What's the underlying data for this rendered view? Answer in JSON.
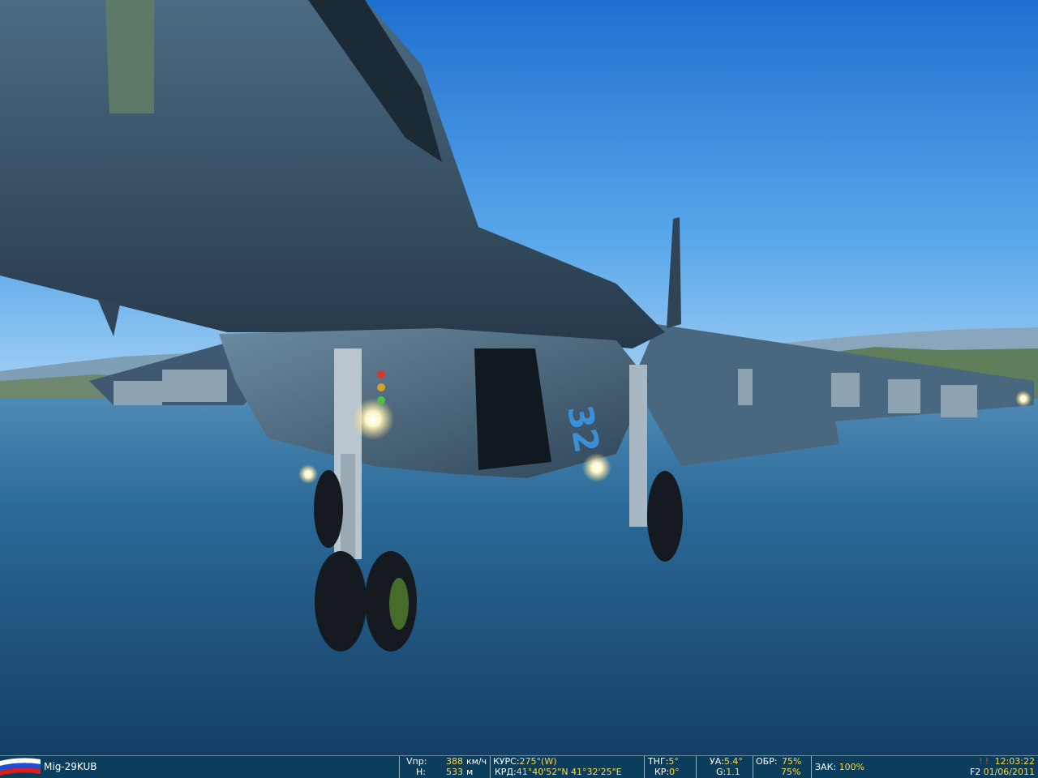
{
  "aircraft": {
    "name": "Mig-29KUB",
    "side_flag": "russia-flag-icon",
    "tail_number": "32"
  },
  "speed": {
    "label": "Vпр:",
    "value": "388",
    "unit": "км/ч"
  },
  "altitude": {
    "label": "H:",
    "value": "533",
    "unit": "м"
  },
  "course": {
    "label": "КУРС:",
    "value": "275°(W)"
  },
  "coords": {
    "label": "КРД:",
    "value": "41°40'52\"N 41°32'25\"E"
  },
  "pitch": {
    "label": "ТНГ:",
    "value": "5°"
  },
  "roll": {
    "label": "КР:",
    "value": "0°"
  },
  "aoa": {
    "label": "УА:",
    "value": "5.4°"
  },
  "gload": {
    "label": "G:",
    "value": "1.1"
  },
  "rpm": {
    "label": "ОБР:",
    "value1": "75%",
    "value2": "75%"
  },
  "flaps": {
    "label": "ЗАК:",
    "value": "100%"
  },
  "clock": {
    "time": "12:03:22",
    "date": "01/06/2011",
    "view_key": "F2",
    "marker": "! !"
  },
  "colors": {
    "bar_bg": "#0b3d5c",
    "value": "#ffd84a",
    "sky": "#3f8fde",
    "sea": "#1d5a84",
    "airframe": "#3d5a72"
  }
}
